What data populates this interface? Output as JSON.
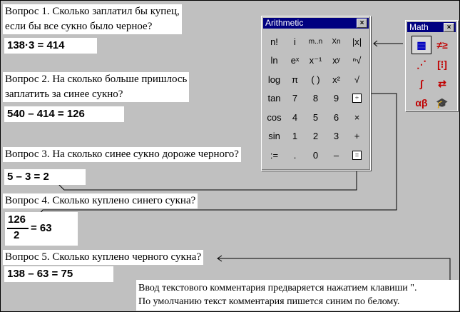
{
  "questions": [
    {
      "lines": [
        "Вопрос 1. Сколько заплатил бы купец,",
        "если бы все сукно было черное?"
      ],
      "equation": "138·3  =  414"
    },
    {
      "lines": [
        "Вопрос 2. На сколько больше пришлось",
        "заплатить за синее сукно?"
      ],
      "equation": "540  –  414  =  126"
    },
    {
      "lines": [
        "Вопрос 3. На сколько синее сукно дороже черного?"
      ],
      "equation": "5  –  3  =  2"
    },
    {
      "lines": [
        "Вопрос 4. Сколько куплено синего сукна?"
      ],
      "fraction": {
        "numerator": "126",
        "denominator": "2",
        "result": "=  63"
      }
    },
    {
      "lines": [
        "Вопрос 5. Сколько куплено черного сукна?"
      ],
      "equation": "138  –  63  =  75"
    }
  ],
  "note": {
    "line1": "Ввод текстового комментария предваряется нажатием клавиши \".",
    "line2": "По умолчанию текст комментария пишется синим по белому."
  },
  "arithmetic_palette": {
    "title": "Arithmetic",
    "close": "×",
    "buttons": [
      "n!",
      "i",
      "m..n",
      "Xn",
      "|x|",
      "ln",
      "eˣ",
      "x⁻¹",
      "xʸ",
      "ⁿ√",
      "log",
      "π",
      "( )",
      "x²",
      "√",
      "tan",
      "7",
      "8",
      "9",
      "÷",
      "cos",
      "4",
      "5",
      "6",
      "×",
      "sin",
      "1",
      "2",
      "3",
      "+",
      ":=",
      ".",
      "0",
      "–",
      "="
    ]
  },
  "math_palette": {
    "title": "Math",
    "close": "×",
    "icons": [
      {
        "name": "calculator-icon",
        "glyph": "▦",
        "color": "#0000c0"
      },
      {
        "name": "evaluation-icon",
        "glyph": "≠≥",
        "color": "#c00000"
      },
      {
        "name": "graph-icon",
        "glyph": "⋰",
        "color": "#c00000"
      },
      {
        "name": "matrix-icon",
        "glyph": "[⁝]",
        "color": "#c00000"
      },
      {
        "name": "calculus-icon",
        "glyph": "∫",
        "color": "#c00000"
      },
      {
        "name": "boolean-icon",
        "glyph": "⇄",
        "color": "#c00000"
      },
      {
        "name": "greek-icon",
        "glyph": "αβ",
        "color": "#c00000"
      },
      {
        "name": "symbolic-icon",
        "glyph": "🎓",
        "color": "#000000"
      }
    ]
  }
}
